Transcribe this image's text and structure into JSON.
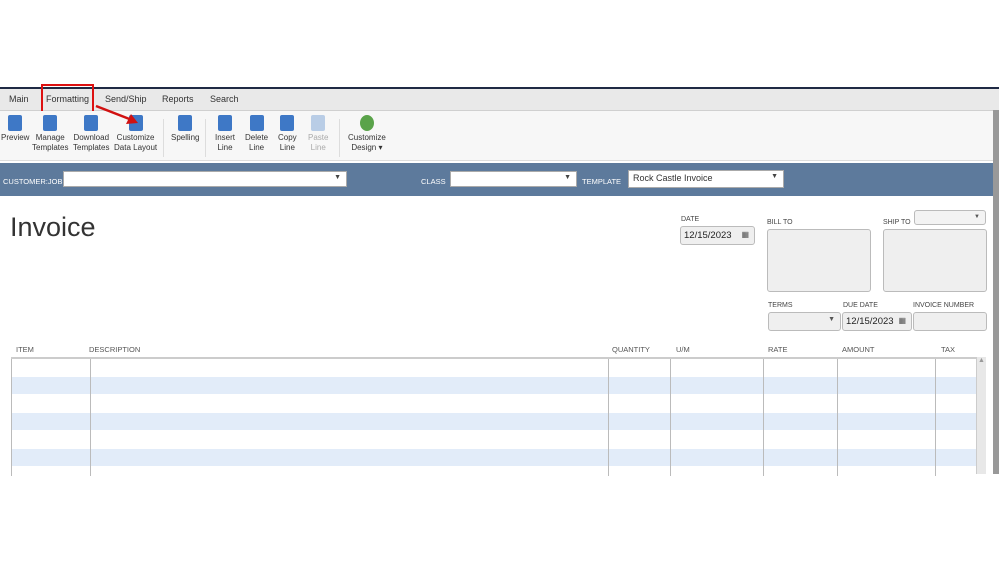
{
  "tabs": [
    {
      "label": "Main"
    },
    {
      "label": "Formatting"
    },
    {
      "label": "Send/Ship"
    },
    {
      "label": "Reports"
    },
    {
      "label": "Search"
    }
  ],
  "toolbar": {
    "preview": "Preview",
    "manage1": "Manage",
    "manage2": "Templates",
    "download1": "Download",
    "download2": "Templates",
    "customize1": "Customize",
    "customize2": "Data Layout",
    "spelling": "Spelling",
    "insert1": "Insert",
    "insert2": "Line",
    "delete1": "Delete",
    "delete2": "Line",
    "copy1": "Copy",
    "copy2": "Line",
    "paste1": "Paste",
    "paste2": "Line",
    "design1": "Customize",
    "design2": "Design ▾"
  },
  "header": {
    "customer_job_label": "CUSTOMER:JOB",
    "customer_job_value": "",
    "class_label": "CLASS",
    "class_value": "",
    "template_label": "TEMPLATE",
    "template_value": "Rock Castle Invoice"
  },
  "form": {
    "title": "Invoice",
    "date_label": "DATE",
    "date": "12/15/2023",
    "bill_to_label": "BILL TO",
    "ship_to_label": "SHIP TO",
    "terms_label": "TERMS",
    "due_date_label": "DUE DATE",
    "due_date": "12/15/2023",
    "invoice_number_label": "INVOICE NUMBER",
    "invoice_number": ""
  },
  "table": {
    "columns": [
      "ITEM",
      "DESCRIPTION",
      "QUANTITY",
      "U/M",
      "RATE",
      "AMOUNT",
      "TAX"
    ]
  },
  "annotation": {
    "highlight_color": "#d11111"
  }
}
